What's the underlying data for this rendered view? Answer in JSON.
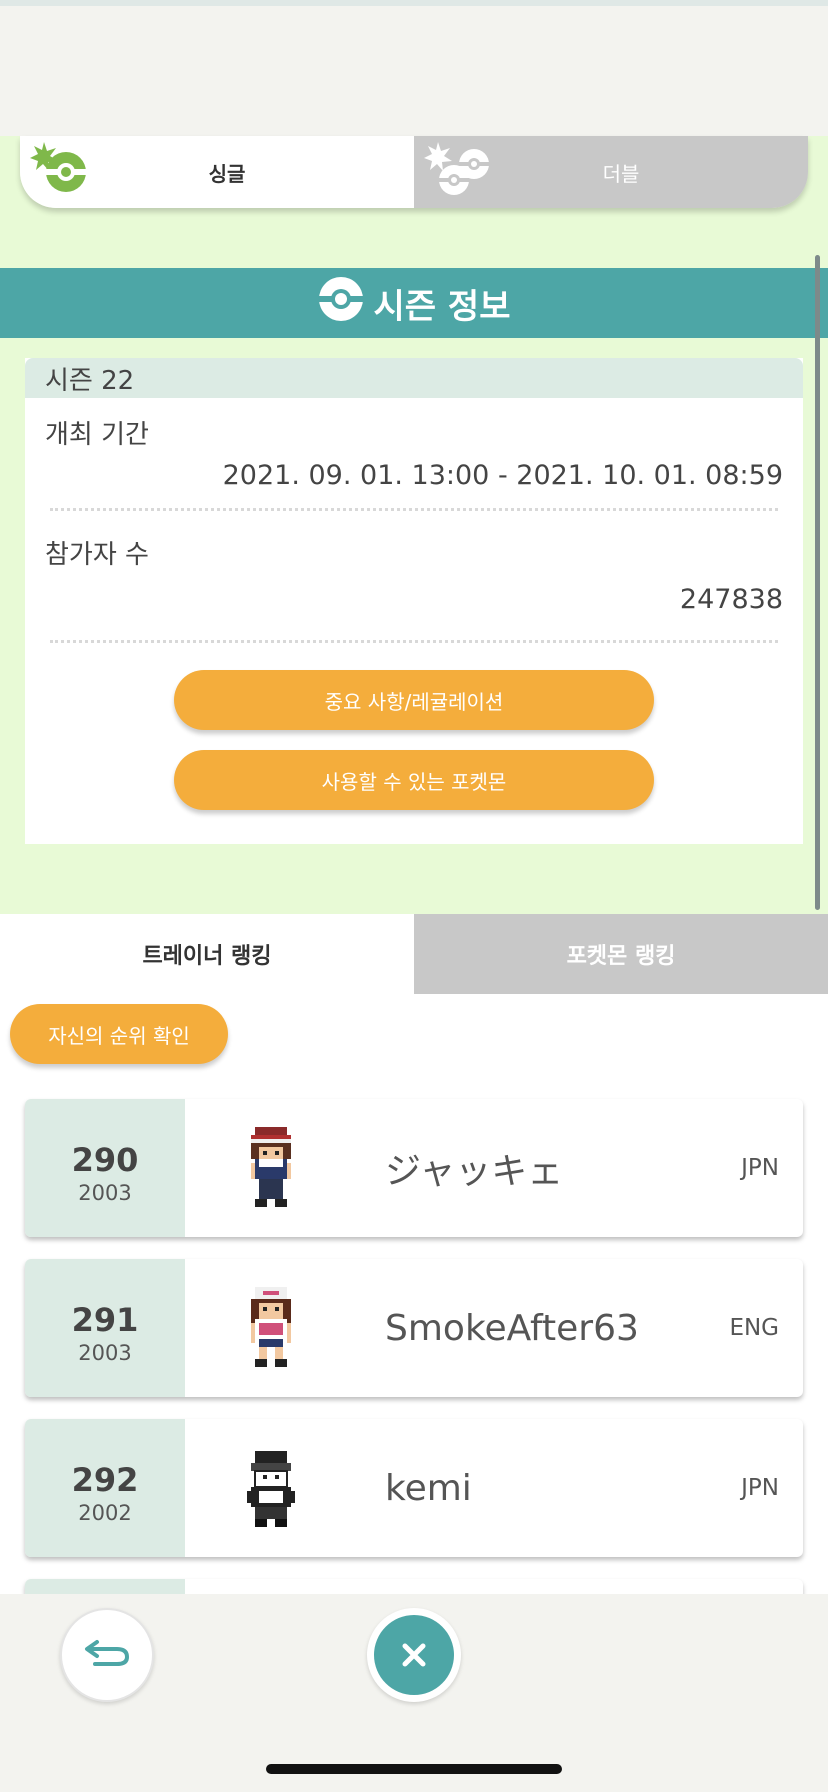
{
  "battle_toggle": {
    "single_label": "싱글",
    "double_label": "더블",
    "selected": "single"
  },
  "season": {
    "header_title": "시즌 정보",
    "season_label": "시즌 22",
    "period_label": "개최 기간",
    "period_value": "2021. 09. 01. 13:00 - 2021. 10. 01. 08:59",
    "participants_label": "참가자 수",
    "participants_value": "247838",
    "rules_button": "중요 사항/레귤레이션",
    "pokemon_button": "사용할 수 있는 포켓몬"
  },
  "ranking_tabs": {
    "trainer": "트레이너 랭킹",
    "pokemon": "포켓몬 랭킹",
    "selected": "trainer"
  },
  "my_rank_button": "자신의 순위 확인",
  "rankings": [
    {
      "rank": "290",
      "rating": "2003",
      "name": "ジャッキェ",
      "lang": "JPN",
      "sprite": "trainer-hilbert-icon"
    },
    {
      "rank": "291",
      "rating": "2003",
      "name": "SmokeAfter63",
      "lang": "ENG",
      "sprite": "trainer-hilda-icon"
    },
    {
      "rank": "292",
      "rating": "2002",
      "name": "kemi",
      "lang": "JPN",
      "sprite": "trainer-red-icon"
    }
  ],
  "colors": {
    "teal": "#4da6a6",
    "orange": "#f4ad3c",
    "light_green": "#e8fad6",
    "mint": "#dcebe4"
  },
  "icons": {
    "back": "back-arrow-icon",
    "close": "close-x-icon"
  }
}
